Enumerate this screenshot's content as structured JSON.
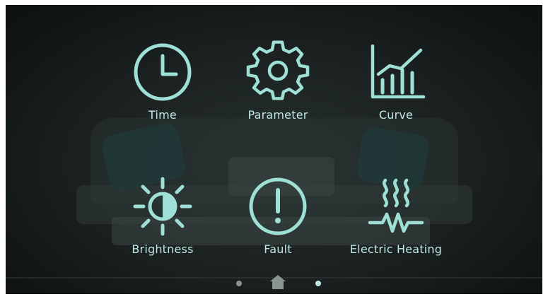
{
  "menu": {
    "items": [
      {
        "label": "Time",
        "icon": "clock-icon"
      },
      {
        "label": "Parameter",
        "icon": "gear-icon"
      },
      {
        "label": "Curve",
        "icon": "bar-chart-trend-icon"
      },
      {
        "label": "Brightness",
        "icon": "brightness-icon"
      },
      {
        "label": "Fault",
        "icon": "alert-circle-icon"
      },
      {
        "label": "Electric Heating",
        "icon": "heating-icon"
      }
    ]
  },
  "nav": {
    "home_icon": "home-icon",
    "page_dots": 2,
    "active_dot": 2
  },
  "colors": {
    "accent": "#9fe0d6",
    "label": "#bfe9e2",
    "background": "#1c2322"
  }
}
